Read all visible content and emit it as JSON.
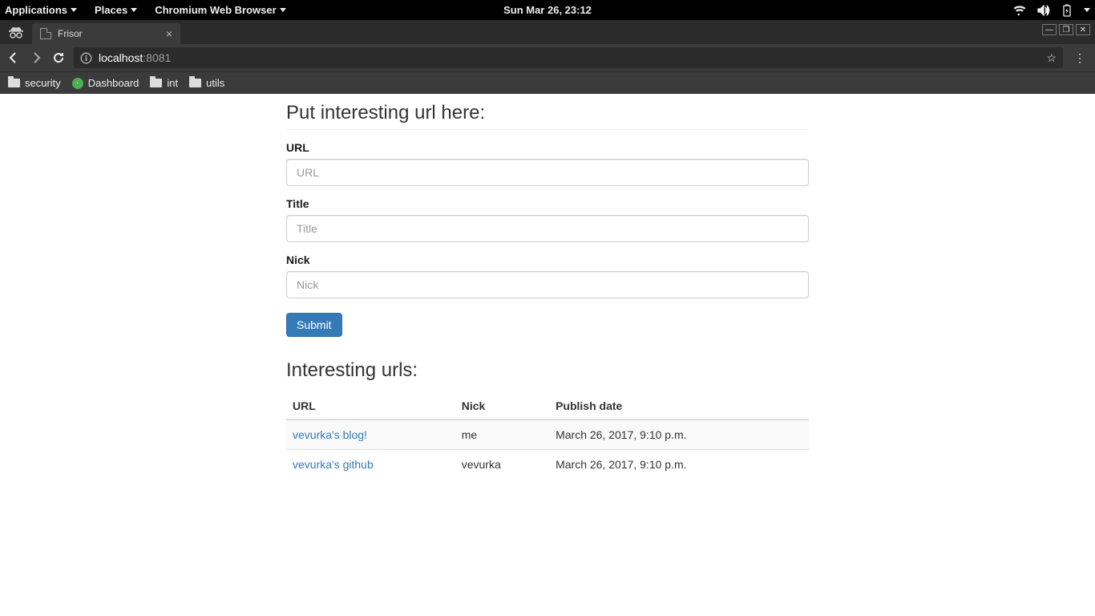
{
  "gnome": {
    "applications": "Applications",
    "places": "Places",
    "app_name": "Chromium Web Browser",
    "clock": "Sun Mar 26, 23:12"
  },
  "browser": {
    "tab_title": "Frisor",
    "url_host": "localhost",
    "url_port": ":8081",
    "bookmarks": [
      {
        "kind": "folder",
        "label": "security"
      },
      {
        "kind": "dash",
        "label": "Dashboard"
      },
      {
        "kind": "folder",
        "label": "int"
      },
      {
        "kind": "folder",
        "label": "utils"
      }
    ]
  },
  "page": {
    "form_heading": "Put interesting url here:",
    "fields": {
      "url": {
        "label": "URL",
        "placeholder": "URL"
      },
      "title": {
        "label": "Title",
        "placeholder": "Title"
      },
      "nick": {
        "label": "Nick",
        "placeholder": "Nick"
      }
    },
    "submit_label": "Submit",
    "list_heading": "Interesting urls:",
    "columns": {
      "url": "URL",
      "nick": "Nick",
      "date": "Publish date"
    },
    "rows": [
      {
        "title": "vevurka's blog!",
        "nick": "me",
        "date": "March 26, 2017, 9:10 p.m."
      },
      {
        "title": "vevurka's github",
        "nick": "vevurka",
        "date": "March 26, 2017, 9:10 p.m."
      }
    ]
  }
}
